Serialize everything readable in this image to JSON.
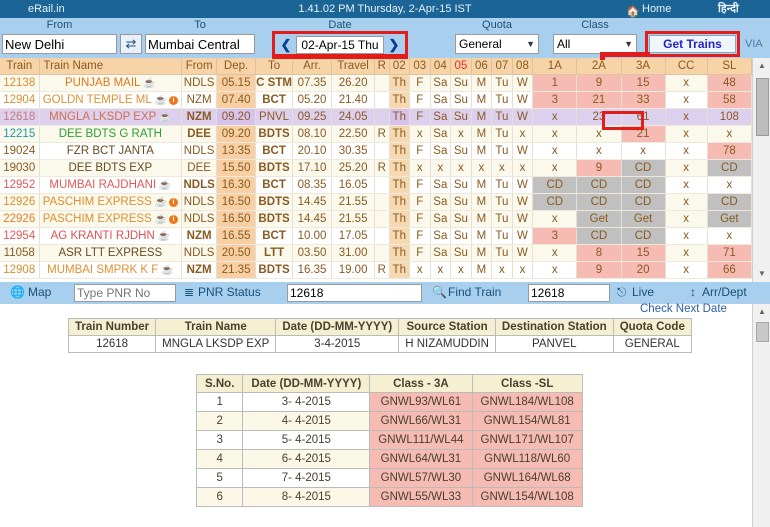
{
  "titlebar": {
    "brand": "eRail.in",
    "clock": "1.41.02 PM Thursday, 2-Apr-15 IST",
    "home": "Home",
    "home_icon": "home-icon",
    "hindi": "हिन्दी"
  },
  "search": {
    "from_label": "From",
    "from_value": "New Delhi",
    "swap_icon": "⇄",
    "to_label": "To",
    "to_value": "Mumbai Central",
    "date_label": "Date",
    "date_value": "02-Apr-15 Thu",
    "prev_icon": "❮",
    "next_icon": "❯",
    "quota_label": "Quota",
    "quota_value": "General",
    "class_label": "Class",
    "class_value": "All",
    "get_trains": "Get Trains",
    "via": "VIA"
  },
  "trains_table": {
    "headers": [
      "Train",
      "Train Name",
      "From",
      "Dep.",
      "To",
      "Arr.",
      "Travel",
      "R",
      "02",
      "03",
      "04",
      "05",
      "06",
      "07",
      "08",
      "1A",
      "2A",
      "3A",
      "CC",
      "SL"
    ],
    "rows": [
      {
        "num": "12138",
        "num_color": "#d98f2a",
        "name": "PUNJAB MAIL",
        "name_color": "#e07818",
        "cup": true,
        "info": false,
        "from": "NDLS",
        "from_bold": false,
        "dep": "05.15",
        "to": "C STM",
        "to_bold": true,
        "arr": "07.35",
        "travel": "26.20",
        "r": "",
        "days": [
          "Th",
          "F",
          "Sa",
          "Su",
          "M",
          "Tu",
          "W"
        ],
        "cls": [
          {
            "v": "1",
            "t": "avail"
          },
          {
            "v": "9",
            "t": "avail"
          },
          {
            "v": "15",
            "t": "avail"
          },
          {
            "v": "x",
            "t": "none"
          },
          {
            "v": "48",
            "t": "avail"
          }
        ],
        "rowstyle": "alt"
      },
      {
        "num": "12904",
        "num_color": "#d98f2a",
        "name": "GOLDN TEMPLE ML",
        "name_color": "#e09030",
        "cup": true,
        "info": true,
        "from": "NZM",
        "from_bold": false,
        "dep": "07.40",
        "to": "BCT",
        "to_bold": true,
        "arr": "05.20",
        "travel": "21.40",
        "r": "",
        "days": [
          "Th",
          "F",
          "Sa",
          "Su",
          "M",
          "Tu",
          "W"
        ],
        "cls": [
          {
            "v": "3",
            "t": "avail"
          },
          {
            "v": "21",
            "t": "avail"
          },
          {
            "v": "33",
            "t": "avail"
          },
          {
            "v": "x",
            "t": "none"
          },
          {
            "v": "58",
            "t": "avail"
          }
        ],
        "rowstyle": "plain"
      },
      {
        "num": "12618",
        "num_color": "#c97a7a",
        "name": "MNGLA LKSDP EXP",
        "name_color": "#d07050",
        "cup": true,
        "info": false,
        "from": "NZM",
        "from_bold": true,
        "dep": "09.20",
        "to": "PNVL",
        "to_bold": false,
        "arr": "09.25",
        "travel": "24.05",
        "r": "",
        "days": [
          "Th",
          "F",
          "Sa",
          "Su",
          "M",
          "Tu",
          "W"
        ],
        "cls": [
          {
            "v": "x",
            "t": "none"
          },
          {
            "v": "23",
            "t": "avail"
          },
          {
            "v": "61",
            "t": "avail"
          },
          {
            "v": "x",
            "t": "none"
          },
          {
            "v": "108",
            "t": "avail"
          }
        ],
        "rowstyle": "sel"
      },
      {
        "num": "12215",
        "num_color": "#1a9aa0",
        "name": "DEE BDTS G RATH",
        "name_color": "#2aa030",
        "cup": false,
        "info": false,
        "from": "DEE",
        "from_bold": true,
        "dep": "09.20",
        "to": "BDTS",
        "to_bold": true,
        "arr": "08.10",
        "travel": "22.50",
        "r": "R",
        "days": [
          "Th",
          "x",
          "Sa",
          "x",
          "M",
          "Tu",
          "x"
        ],
        "cls": [
          {
            "v": "x",
            "t": "none"
          },
          {
            "v": "x",
            "t": "none"
          },
          {
            "v": "21",
            "t": "avail"
          },
          {
            "v": "x",
            "t": "none"
          },
          {
            "v": "x",
            "t": "none"
          }
        ],
        "rowstyle": "alt"
      },
      {
        "num": "19024",
        "num_color": "#8a5a20",
        "name": "FZR BCT JANTA",
        "name_color": "#6a4a20",
        "cup": false,
        "info": false,
        "from": "NDLS",
        "from_bold": false,
        "dep": "13.35",
        "to": "BCT",
        "to_bold": true,
        "arr": "20.10",
        "travel": "30.35",
        "r": "",
        "days": [
          "Th",
          "F",
          "Sa",
          "Su",
          "M",
          "Tu",
          "W"
        ],
        "cls": [
          {
            "v": "x",
            "t": "none"
          },
          {
            "v": "x",
            "t": "none"
          },
          {
            "v": "x",
            "t": "none"
          },
          {
            "v": "x",
            "t": "none"
          },
          {
            "v": "78",
            "t": "avail"
          }
        ],
        "rowstyle": "plain"
      },
      {
        "num": "19030",
        "num_color": "#8a5a20",
        "name": "DEE BDTS EXP",
        "name_color": "#6a4a20",
        "cup": false,
        "info": false,
        "from": "DEE",
        "from_bold": false,
        "dep": "15.50",
        "to": "BDTS",
        "to_bold": true,
        "arr": "17.10",
        "travel": "25.20",
        "r": "R",
        "days": [
          "Th",
          "x",
          "x",
          "x",
          "x",
          "x",
          "x"
        ],
        "cls": [
          {
            "v": "x",
            "t": "none"
          },
          {
            "v": "9",
            "t": "avail"
          },
          {
            "v": "CD",
            "t": "cd"
          },
          {
            "v": "x",
            "t": "none"
          },
          {
            "v": "CD",
            "t": "cd"
          }
        ],
        "rowstyle": "alt"
      },
      {
        "num": "12952",
        "num_color": "#e05858",
        "name": "MUMBAI RAJDHANI",
        "name_color": "#e05858",
        "cup": true,
        "info": false,
        "from": "NDLS",
        "from_bold": true,
        "dep": "16.30",
        "to": "BCT",
        "to_bold": true,
        "arr": "08.35",
        "travel": "16.05",
        "r": "",
        "days": [
          "Th",
          "F",
          "Sa",
          "Su",
          "M",
          "Tu",
          "W"
        ],
        "cls": [
          {
            "v": "CD",
            "t": "cd"
          },
          {
            "v": "CD",
            "t": "cd"
          },
          {
            "v": "CD",
            "t": "cd"
          },
          {
            "v": "x",
            "t": "none"
          },
          {
            "v": "x",
            "t": "none"
          }
        ],
        "rowstyle": "plain"
      },
      {
        "num": "12926",
        "num_color": "#d98f2a",
        "name": "PASCHIM EXPRESS",
        "name_color": "#e09030",
        "cup": true,
        "info": true,
        "from": "NDLS",
        "from_bold": false,
        "dep": "16.50",
        "to": "BDTS",
        "to_bold": true,
        "arr": "14.45",
        "travel": "21.55",
        "r": "",
        "days": [
          "Th",
          "F",
          "Sa",
          "Su",
          "M",
          "Tu",
          "W"
        ],
        "cls": [
          {
            "v": "CD",
            "t": "cd"
          },
          {
            "v": "CD",
            "t": "cd"
          },
          {
            "v": "CD",
            "t": "cd"
          },
          {
            "v": "x",
            "t": "none"
          },
          {
            "v": "CD",
            "t": "cd"
          }
        ],
        "rowstyle": "alt"
      },
      {
        "num": "22926",
        "num_color": "#e08030",
        "name": "PASCHIM EXPRESS",
        "name_color": "#e09030",
        "cup": true,
        "info": true,
        "from": "NDLS",
        "from_bold": false,
        "dep": "16.50",
        "to": "BDTS",
        "to_bold": true,
        "arr": "14.45",
        "travel": "21.55",
        "r": "",
        "days": [
          "Th",
          "F",
          "Sa",
          "Su",
          "M",
          "Tu",
          "W"
        ],
        "cls": [
          {
            "v": "x",
            "t": "none"
          },
          {
            "v": "Get",
            "t": "cd"
          },
          {
            "v": "Get",
            "t": "cd"
          },
          {
            "v": "x",
            "t": "none"
          },
          {
            "v": "Get",
            "t": "cd"
          }
        ],
        "rowstyle": "alt"
      },
      {
        "num": "12954",
        "num_color": "#e05858",
        "name": "AG KRANTI RJDHN",
        "name_color": "#e05050",
        "cup": true,
        "info": false,
        "from": "NZM",
        "from_bold": true,
        "dep": "16.55",
        "to": "BCT",
        "to_bold": true,
        "arr": "10.00",
        "travel": "17.05",
        "r": "",
        "days": [
          "Th",
          "F",
          "Sa",
          "Su",
          "M",
          "Tu",
          "W"
        ],
        "cls": [
          {
            "v": "3",
            "t": "avail"
          },
          {
            "v": "CD",
            "t": "cd"
          },
          {
            "v": "CD",
            "t": "cd"
          },
          {
            "v": "x",
            "t": "none"
          },
          {
            "v": "x",
            "t": "none"
          }
        ],
        "rowstyle": "plain"
      },
      {
        "num": "11058",
        "num_color": "#8a5a20",
        "name": "ASR LTT EXPRESS",
        "name_color": "#6a4a20",
        "cup": false,
        "info": false,
        "from": "NDLS",
        "from_bold": false,
        "dep": "20.50",
        "to": "LTT",
        "to_bold": true,
        "arr": "03.50",
        "travel": "31.00",
        "r": "",
        "days": [
          "Th",
          "F",
          "Sa",
          "Su",
          "M",
          "Tu",
          "W"
        ],
        "cls": [
          {
            "v": "x",
            "t": "none"
          },
          {
            "v": "8",
            "t": "avail"
          },
          {
            "v": "15",
            "t": "avail"
          },
          {
            "v": "x",
            "t": "none"
          },
          {
            "v": "71",
            "t": "avail"
          }
        ],
        "rowstyle": "alt"
      },
      {
        "num": "12908",
        "num_color": "#d98f2a",
        "name": "MUMBAI SMPRK K F",
        "name_color": "#e09030",
        "cup": true,
        "info": false,
        "from": "NZM",
        "from_bold": true,
        "dep": "21.35",
        "to": "BDTS",
        "to_bold": true,
        "arr": "16.35",
        "travel": "19.00",
        "r": "R",
        "days": [
          "Th",
          "x",
          "x",
          "x",
          "M",
          "x",
          "x"
        ],
        "cls": [
          {
            "v": "x",
            "t": "none"
          },
          {
            "v": "9",
            "t": "avail"
          },
          {
            "v": "20",
            "t": "avail"
          },
          {
            "v": "x",
            "t": "none"
          },
          {
            "v": "66",
            "t": "avail"
          }
        ],
        "rowstyle": "plain"
      }
    ]
  },
  "toolbar": {
    "map": "Map",
    "map_icon": "globe-icon",
    "pnr_placeholder": "Type PNR No",
    "pnr_status": "PNR Status",
    "pnr_status_icon": "list-icon",
    "find_train_value": "12618",
    "find_train": "Find Train",
    "find_train_icon": "search-icon",
    "live_value": "12618",
    "live": "Live",
    "live_icon": "bell-icon",
    "arrdept": "Arr/Dept",
    "arrdept_icon": "updown-arrow-icon",
    "check_next_date": "Check Next Date"
  },
  "info_table": {
    "headers": [
      "Train Number",
      "Train Name",
      "Date (DD-MM-YYYY)",
      "Source Station",
      "Destination Station",
      "Quota Code"
    ],
    "row": [
      "12618",
      "MNGLA LKSDP EXP",
      "3-4-2015",
      "H NIZAMUDDIN",
      "PANVEL",
      "GENERAL"
    ]
  },
  "avail_table": {
    "headers": [
      "S.No.",
      "Date (DD-MM-YYYY)",
      "Class - 3A",
      "Class -SL"
    ],
    "rows": [
      [
        "1",
        "3- 4-2015",
        "GNWL93/WL61",
        "GNWL184/WL108"
      ],
      [
        "2",
        "4- 4-2015",
        "GNWL66/WL31",
        "GNWL154/WL81"
      ],
      [
        "3",
        "5- 4-2015",
        "GNWL111/WL44",
        "GNWL171/WL107"
      ],
      [
        "4",
        "6- 4-2015",
        "GNWL64/WL31",
        "GNWL118/WL60"
      ],
      [
        "5",
        "7- 4-2015",
        "GNWL57/WL30",
        "GNWL164/WL68"
      ],
      [
        "6",
        "8- 4-2015",
        "GNWL55/WL33",
        "GNWL154/WL108"
      ]
    ]
  },
  "colors": {
    "titlebar_bg": "#1a6496",
    "searchbar_bg": "#a8d0ee",
    "header_bg": "#f6d4a8",
    "highlight_red": "#e21b1b",
    "selected_row": "#ddd0ee",
    "avail_pink": "#f6bbb3",
    "cd_gray": "#c0c0c0"
  }
}
